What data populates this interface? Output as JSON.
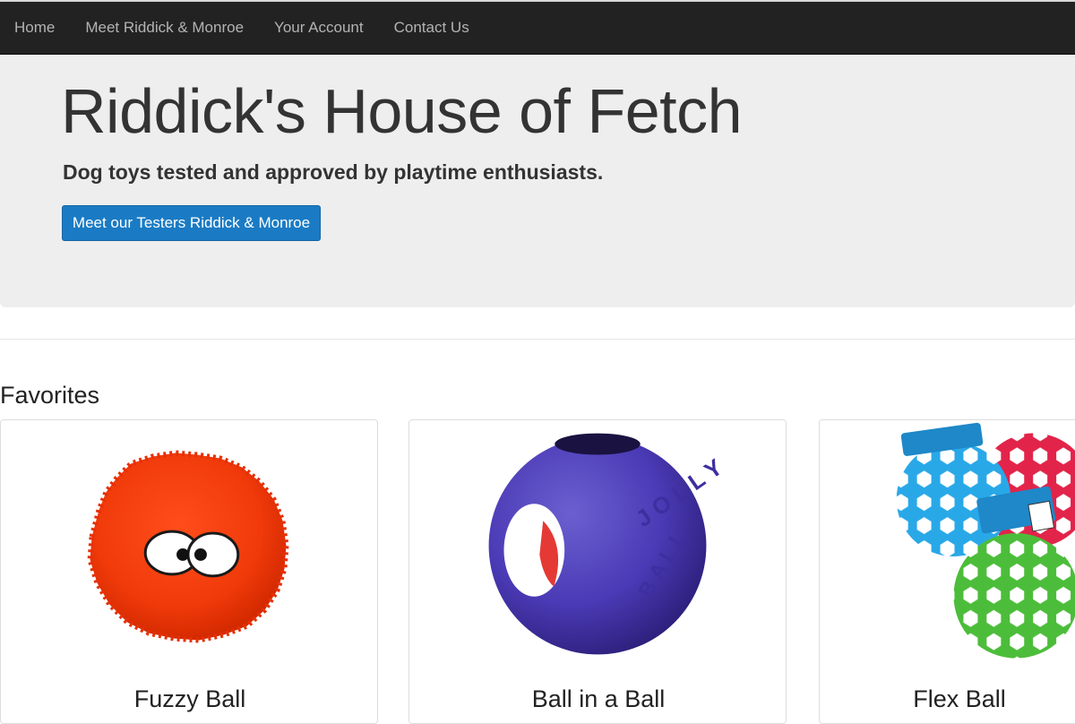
{
  "nav": {
    "items": [
      {
        "label": "Home"
      },
      {
        "label": "Meet Riddick & Monroe"
      },
      {
        "label": "Your Account"
      },
      {
        "label": "Contact Us"
      }
    ]
  },
  "jumbotron": {
    "title": "Riddick's House of Fetch",
    "subtitle": "Dog toys tested and approved by playtime enthusiasts.",
    "button_label": "Meet our Testers Riddick & Monroe"
  },
  "favorites": {
    "title": "Favorites",
    "products": [
      {
        "name": "Fuzzy Ball",
        "image": "fuzzy-orange-ball"
      },
      {
        "name": "Ball in a Ball",
        "image": "purple-jolly-ball"
      },
      {
        "name": "Flex Ball",
        "image": "holee-roller-balls"
      }
    ]
  },
  "colors": {
    "navbar": "#222222",
    "jumbotron": "#eeeeee",
    "primary_button": "#1a7bc4"
  }
}
